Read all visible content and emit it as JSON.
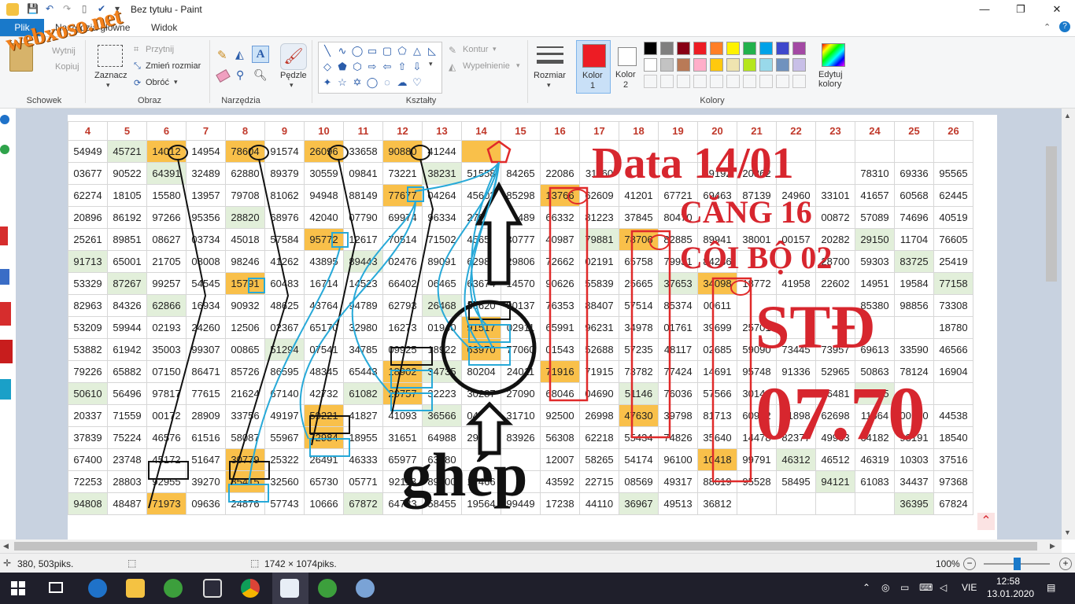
{
  "window": {
    "title": "Bez tytułu - Paint",
    "minimize": "—",
    "maximize": "❐",
    "close": "✕"
  },
  "watermark": "webxoso.net",
  "menu": {
    "file": "Plik",
    "tabs": [
      "Narzędzia główne",
      "Widok"
    ]
  },
  "ribbon": {
    "clipboard": {
      "group": "Schowek",
      "cut": "Wytnij",
      "copy": "Kopiuj"
    },
    "image": {
      "group": "Obraz",
      "select": "Zaznacz",
      "crop": "Przytnij",
      "resize": "Zmień rozmiar",
      "rotate": "Obróć"
    },
    "tools": {
      "group": "Narzędzia"
    },
    "brushes": {
      "label": "Pędzle"
    },
    "shapes": {
      "group": "Kształty",
      "outline": "Kontur",
      "fill": "Wypełnienie"
    },
    "size": {
      "label": "Rozmiar"
    },
    "color1": {
      "label": "Kolor",
      "num": "1",
      "value": "#ed1c24"
    },
    "color2": {
      "label": "Kolor",
      "num": "2",
      "value": "#ffffff"
    },
    "colors_group": "Kolory",
    "edit_colors": "Edytuj kolory",
    "palette": [
      "#000000",
      "#7f7f7f",
      "#880015",
      "#ed1c24",
      "#ff7f27",
      "#fff200",
      "#22b14c",
      "#00a2e8",
      "#3f48cc",
      "#a349a4",
      "#ffffff",
      "#c3c3c3",
      "#b97a57",
      "#ffaec9",
      "#ffc90e",
      "#efe4b0",
      "#b5e61d",
      "#99d9ea",
      "#7092be",
      "#c8bfe7"
    ]
  },
  "grid": {
    "columns": [
      "4",
      "5",
      "6",
      "7",
      "8",
      "9",
      "10",
      "11",
      "12",
      "13",
      "14",
      "15",
      "16",
      "17",
      "18",
      "19",
      "20",
      "21",
      "22",
      "23",
      "24",
      "25",
      "26"
    ],
    "rows": [
      [
        "54949",
        "45721",
        "14012",
        "14954",
        "78604",
        "91574",
        "26096",
        "33658",
        "90880",
        "41244",
        "",
        "",
        "",
        "",
        "",
        "",
        "",
        "",
        "",
        "",
        "",
        "",
        ""
      ],
      [
        "03677",
        "90522",
        "64391",
        "32489",
        "62880",
        "89379",
        "30559",
        "09841",
        "73221",
        "38231",
        "51558",
        "84265",
        "22086",
        "31160",
        "",
        "",
        "69192",
        "20362",
        "",
        "",
        "78310",
        "69336",
        "95565"
      ],
      [
        "62274",
        "18105",
        "15580",
        "13957",
        "79708",
        "81062",
        "94948",
        "88149",
        "77677",
        "04264",
        "45603",
        "85298",
        "13766",
        "62609",
        "41201",
        "67721",
        "69463",
        "87139",
        "24960",
        "33101",
        "41657",
        "60568",
        "62445"
      ],
      [
        "20896",
        "86192",
        "97266",
        "95356",
        "28820",
        "68976",
        "42040",
        "07790",
        "69974",
        "96334",
        "27659",
        "02489",
        "66332",
        "81223",
        "37845",
        "80470",
        "",
        "",
        "",
        "00872",
        "57089",
        "74696",
        "40519"
      ],
      [
        "25261",
        "89851",
        "08627",
        "03734",
        "45018",
        "57584",
        "95772",
        "12617",
        "70514",
        "71502",
        "45652",
        "30777",
        "40987",
        "79881",
        "78706",
        "82885",
        "89941",
        "38001",
        "00157",
        "20282",
        "29150",
        "11704",
        "76605"
      ],
      [
        "91713",
        "65001",
        "21705",
        "08008",
        "98246",
        "41262",
        "43895",
        "89443",
        "02476",
        "89091",
        "62988",
        "29806",
        "72662",
        "02191",
        "65758",
        "79931",
        "84266",
        "",
        "",
        "28700",
        "59303",
        "83725",
        "25419"
      ],
      [
        "53329",
        "87267",
        "99257",
        "54545",
        "15791",
        "60483",
        "16714",
        "14523",
        "66402",
        "06465",
        "63674",
        "14570",
        "90626",
        "55839",
        "25665",
        "37653",
        "34098",
        "18772",
        "41958",
        "22602",
        "14951",
        "19584",
        "77158"
      ],
      [
        "82963",
        "84326",
        "62866",
        "16934",
        "90932",
        "48625",
        "43764",
        "94789",
        "62793",
        "26468",
        "33620",
        "90137",
        "76353",
        "88407",
        "57514",
        "85374",
        "00611",
        "",
        "",
        "",
        "85380",
        "98856",
        "73308"
      ],
      [
        "53209",
        "59944",
        "02193",
        "24260",
        "12506",
        "02367",
        "65170",
        "32980",
        "16273",
        "01940",
        "91517",
        "02911",
        "65991",
        "96231",
        "34978",
        "01761",
        "39699",
        "25701",
        "",
        "",
        "",
        "",
        "18780"
      ],
      [
        "53882",
        "61942",
        "35003",
        "99307",
        "00865",
        "51294",
        "07541",
        "34785",
        "09925",
        "18922",
        "63970",
        "77060",
        "01543",
        "52688",
        "57235",
        "48117",
        "02685",
        "59090",
        "73445",
        "73957",
        "69613",
        "33590",
        "46566"
      ],
      [
        "79226",
        "65882",
        "07150",
        "86471",
        "85726",
        "86595",
        "48345",
        "65443",
        "18902",
        "34735",
        "80204",
        "24011",
        "71916",
        "71915",
        "73782",
        "77424",
        "14691",
        "95748",
        "91336",
        "52965",
        "50863",
        "78124",
        "16904"
      ],
      [
        "50610",
        "56496",
        "97817",
        "77615",
        "21624",
        "67140",
        "42732",
        "61082",
        "20757",
        "32223",
        "30287",
        "27090",
        "68046",
        "04690",
        "51146",
        "76036",
        "57566",
        "30143",
        "",
        "66481",
        "08225",
        "",
        ""
      ],
      [
        "20337",
        "71559",
        "00172",
        "28909",
        "33756",
        "49197",
        "59221",
        "41827",
        "41093",
        "36566",
        "04278",
        "31710",
        "92500",
        "26998",
        "47630",
        "39798",
        "81713",
        "60922",
        "21898",
        "62698",
        "11564",
        "00520",
        "44538"
      ],
      [
        "37839",
        "75224",
        "46576",
        "61516",
        "58087",
        "55967",
        "72984",
        "18955",
        "31651",
        "64988",
        "29348",
        "83926",
        "56308",
        "62218",
        "55434",
        "74826",
        "35640",
        "14478",
        "82377",
        "49963",
        "64182",
        "93191",
        "18540"
      ],
      [
        "67400",
        "23748",
        "45172",
        "51647",
        "30779",
        "25322",
        "26491",
        "46333",
        "65977",
        "63180",
        "",
        "",
        "12007",
        "58265",
        "54174",
        "96100",
        "10418",
        "99791",
        "46312",
        "46512",
        "46319",
        "10303",
        "37516"
      ],
      [
        "72253",
        "28803",
        "92955",
        "39270",
        "85415",
        "32560",
        "65730",
        "05771",
        "92118",
        "89300",
        "17466",
        "",
        "43592",
        "22715",
        "08569",
        "49317",
        "88619",
        "95528",
        "58495",
        "94121",
        "61083",
        "34437",
        "97368"
      ],
      [
        "94808",
        "48487",
        "71973",
        "09636",
        "24876",
        "57743",
        "10666",
        "67872",
        "64783",
        "58455",
        "19564",
        "99449",
        "17238",
        "44110",
        "36967",
        "49513",
        "36812",
        "",
        "",
        "",
        "",
        "36395",
        "67824"
      ]
    ]
  },
  "overlay": {
    "line1": "Data 14/01",
    "line2": "CĂNG 16",
    "line3": "CÔI BỘ 02",
    "line4": "STĐ",
    "line5": "07.70",
    "label": "ghép"
  },
  "status": {
    "cursor": "380, 503piks.",
    "size": "1742 × 1074piks.",
    "zoom": "100%"
  },
  "taskbar": {
    "lang": "VIE",
    "time": "12:58",
    "date": "13.01.2020"
  }
}
